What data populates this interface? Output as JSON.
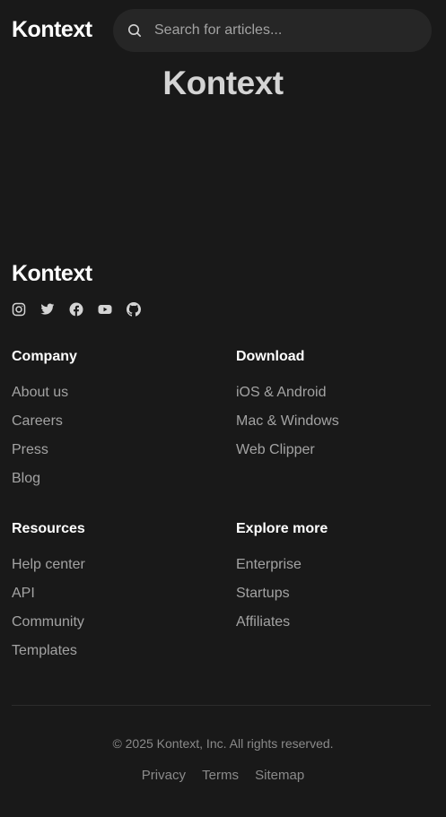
{
  "header": {
    "logo": "Kontext",
    "search_placeholder": "Search for articles..."
  },
  "hero": {
    "title": "Kontext"
  },
  "footer": {
    "logo": "Kontext",
    "social_icons": [
      "instagram-icon",
      "twitter-icon",
      "facebook-icon",
      "youtube-icon",
      "github-icon"
    ],
    "columns": [
      {
        "heading": "Company",
        "links": [
          "About us",
          "Careers",
          "Press",
          "Blog"
        ]
      },
      {
        "heading": "Download",
        "links": [
          "iOS & Android",
          "Mac & Windows",
          "Web Clipper"
        ]
      },
      {
        "heading": "Resources",
        "links": [
          "Help center",
          "API",
          "Community",
          "Templates"
        ]
      },
      {
        "heading": "Explore more",
        "links": [
          "Enterprise",
          "Startups",
          "Affiliates"
        ]
      }
    ],
    "copyright": "© 2025 Kontext, Inc. All rights reserved.",
    "legal_links": [
      "Privacy",
      "Terms",
      "Sitemap"
    ]
  },
  "colors": {
    "background": "#191919",
    "search_bg": "#262626",
    "text_primary": "#ffffff",
    "text_muted": "#a3a3a3",
    "hero_title": "#d4d4d4"
  }
}
